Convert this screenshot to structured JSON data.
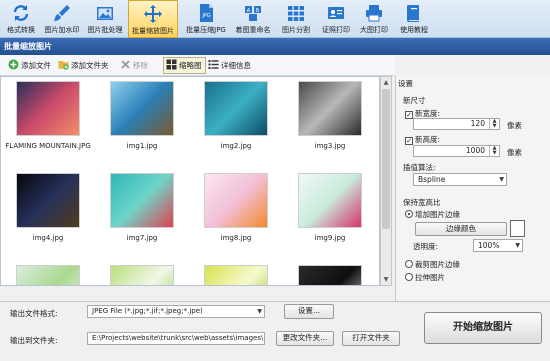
{
  "ribbon": {
    "items": [
      {
        "label": "格式转换",
        "icon": "refresh-arrows-icon"
      },
      {
        "label": "图片加水印",
        "icon": "brush-icon"
      },
      {
        "label": "图片批处理",
        "icon": "images-icon"
      },
      {
        "label": "批量缩放图片",
        "icon": "resize-arrows-icon"
      },
      {
        "label": "批量压缩JPG",
        "icon": "jpg-file-icon"
      },
      {
        "label": "着图重命名",
        "icon": "rename-icon"
      },
      {
        "label": "图片分割",
        "icon": "grid-split-icon"
      },
      {
        "label": "证照打印",
        "icon": "id-card-icon"
      },
      {
        "label": "大图打印",
        "icon": "printer-icon"
      },
      {
        "label": "使用教程",
        "icon": "book-icon"
      }
    ]
  },
  "window": {
    "title": "批量缩放图片"
  },
  "toolbar": {
    "add_file": "添加文件",
    "add_folder": "添加文件夹",
    "remove": "移除",
    "thumbnail": "缩略图",
    "details": "详细信息"
  },
  "images": [
    {
      "name": "FLAMING MOUNTAIN.JPG",
      "colors": [
        "#2b2f5a",
        "#c94a6a",
        "#f28d6a"
      ]
    },
    {
      "name": "img1.jpg",
      "colors": [
        "#8fd0ee",
        "#2a7fb5",
        "#7a5b2e"
      ]
    },
    {
      "name": "img2.jpg",
      "colors": [
        "#1a6f8f",
        "#3bb0c4",
        "#0d4c66"
      ]
    },
    {
      "name": "img3.jpg",
      "colors": [
        "#4a4a4a",
        "#b8b8b8",
        "#2b2b2b"
      ]
    },
    {
      "name": "img4.jpg",
      "colors": [
        "#05060d",
        "#26305a",
        "#4f3c1c"
      ]
    },
    {
      "name": "img7.jpg",
      "colors": [
        "#2fb6b8",
        "#6fd4c8",
        "#e0414f"
      ]
    },
    {
      "name": "img8.jpg",
      "colors": [
        "#fbe7f0",
        "#f2c0d8",
        "#f28a2c"
      ]
    },
    {
      "name": "img9.jpg",
      "colors": [
        "#f4f7f7",
        "#c9ecdc",
        "#d6306d"
      ]
    },
    {
      "name": "",
      "colors": [
        "#d8eedd",
        "#a9d98f",
        "#f2f6f0"
      ]
    },
    {
      "name": "",
      "colors": [
        "#b7e07a",
        "#f2f7e8",
        "#8fcf5a"
      ]
    },
    {
      "name": "",
      "colors": [
        "#d6e34a",
        "#f7f9cf",
        "#9abf2f"
      ]
    },
    {
      "name": "",
      "colors": [
        "#2a2a2a",
        "#0f0f0f",
        "#cfcfcf"
      ]
    }
  ],
  "settings": {
    "header": "设置",
    "new_size": "新尺寸",
    "new_width_label": "新宽度:",
    "new_width_value": "120",
    "new_height_label": "新高度:",
    "new_height_value": "1000",
    "unit": "像素",
    "interp_label": "插值算法:",
    "interp_value": "Bspline",
    "keep_ratio": "保持宽高比",
    "add_border": "增加图片边缘",
    "border_color_btn": "边缘颜色",
    "transparency_label": "透明度:",
    "transparency_value": "100%",
    "crop_edge": "裁剪图片边缘",
    "stretch": "拉伸图片"
  },
  "bottom": {
    "format_label": "输出文件格式:",
    "format_value": "JPEG File (*.jpg;*.jif;*.jpeg;*.jpe)",
    "settings_btn": "设置...",
    "folder_label": "输出到文件夹:",
    "folder_value": "E:\\Projects\\website\\trunk\\src\\web\\assets\\images\\",
    "change_folder_btn": "更改文件夹...",
    "open_folder_btn": "打开文件夹",
    "start_btn": "开始缩放图片"
  }
}
